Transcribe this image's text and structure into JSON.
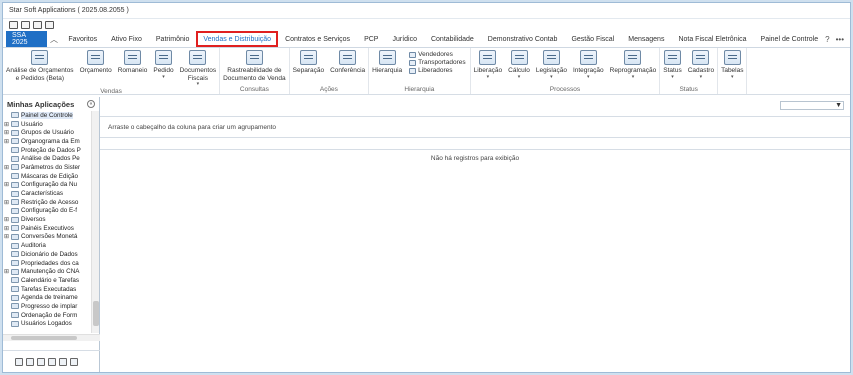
{
  "window": {
    "title": "Star Soft Applications ( 2025.08.2055 )"
  },
  "quick_access": [
    "pin-icon",
    "grid-icon",
    "save-icon",
    "copy-icon"
  ],
  "tabs": {
    "app": "SSA 2025",
    "items": [
      "Favoritos",
      "Ativo Fixo",
      "Patrimônio",
      "Vendas e Distribuição",
      "Contratos e Serviços",
      "PCP",
      "Jurídico",
      "Contabilidade",
      "Demonstrativo Contab",
      "Gestão Fiscal",
      "Mensagens",
      "Nota Fiscal Eletrônica",
      "Painel de Controle"
    ],
    "active": "Vendas e Distribuição",
    "help": "?",
    "more": "•••"
  },
  "ribbon": {
    "groups": [
      {
        "label": "Vendas",
        "buttons": [
          {
            "line1": "Análise de Orçamentos",
            "line2": "e Pedidos (Beta)",
            "dropdown": false
          },
          {
            "line1": "Orçamento",
            "line2": "",
            "dropdown": false
          },
          {
            "line1": "Romaneio",
            "line2": "",
            "dropdown": false
          },
          {
            "line1": "Pedido",
            "line2": "",
            "dropdown": true
          },
          {
            "line1": "Documentos",
            "line2": "Fiscais",
            "dropdown": true
          }
        ]
      },
      {
        "label": "Consultas",
        "buttons": [
          {
            "line1": "Rastreabilidade de",
            "line2": "Documento de Venda",
            "dropdown": false
          }
        ]
      },
      {
        "label": "Ações",
        "buttons": [
          {
            "line1": "Separação",
            "line2": "",
            "dropdown": false
          },
          {
            "line1": "Conferência",
            "line2": "",
            "dropdown": false
          }
        ]
      },
      {
        "label": "Hierarquia",
        "buttons": [
          {
            "line1": "Hierarquia",
            "line2": "",
            "dropdown": false
          }
        ],
        "small": [
          "Vendedores",
          "Transportadores",
          "Liberadores"
        ]
      },
      {
        "label": "Processos",
        "buttons": [
          {
            "line1": "Liberação",
            "line2": "",
            "dropdown": true
          },
          {
            "line1": "Cálculo",
            "line2": "",
            "dropdown": true
          },
          {
            "line1": "Legislação",
            "line2": "",
            "dropdown": true
          },
          {
            "line1": "Integração",
            "line2": "",
            "dropdown": true
          },
          {
            "line1": "Reprogramação",
            "line2": "",
            "dropdown": true
          }
        ]
      },
      {
        "label": "Status",
        "buttons": [
          {
            "line1": "Status",
            "line2": "",
            "dropdown": true
          },
          {
            "line1": "Cadastro",
            "line2": "",
            "dropdown": true
          }
        ]
      },
      {
        "label": "",
        "buttons": [
          {
            "line1": "Tabelas",
            "line2": "",
            "dropdown": true
          }
        ]
      }
    ]
  },
  "sidebar": {
    "title": "Minhas Aplicações",
    "items": [
      {
        "label": "Painel de Controle",
        "expander": "",
        "selected": true
      },
      {
        "label": "Usuário",
        "expander": "⊞"
      },
      {
        "label": "Grupos de Usuário",
        "expander": "⊞"
      },
      {
        "label": "Organograma da Em",
        "expander": "⊞"
      },
      {
        "label": "Proteção de Dados P",
        "expander": ""
      },
      {
        "label": "Análise de Dados Pe",
        "expander": ""
      },
      {
        "label": "Parâmetros do Sister",
        "expander": "⊞"
      },
      {
        "label": "Máscaras de Edição",
        "expander": ""
      },
      {
        "label": "Configuração da Nu",
        "expander": "⊞"
      },
      {
        "label": "Características",
        "expander": ""
      },
      {
        "label": "Restrição de Acesso",
        "expander": "⊞"
      },
      {
        "label": "Configuração do E-f",
        "expander": ""
      },
      {
        "label": "Diversos",
        "expander": "⊞"
      },
      {
        "label": "Painéis Executivos",
        "expander": "⊞"
      },
      {
        "label": "Conversões Monetá",
        "expander": "⊞"
      },
      {
        "label": "Auditoria",
        "expander": ""
      },
      {
        "label": "Dicionário de Dados",
        "expander": ""
      },
      {
        "label": "Propriedades dos ca",
        "expander": ""
      },
      {
        "label": "Manutenção do CNA",
        "expander": "⊞"
      },
      {
        "label": "Calendário e Tarefas",
        "expander": ""
      },
      {
        "label": "Tarefas Executadas",
        "expander": ""
      },
      {
        "label": "Agenda de treiname",
        "expander": ""
      },
      {
        "label": "Progresso de implar",
        "expander": ""
      },
      {
        "label": "Ordenação de Form",
        "expander": ""
      },
      {
        "label": "Usuários Logados",
        "expander": ""
      }
    ]
  },
  "content": {
    "search_placeholder": "",
    "group_hint": "Arraste o cabeçalho da coluna para criar um agrupamento",
    "empty_message": "Não há registros para exibição"
  }
}
